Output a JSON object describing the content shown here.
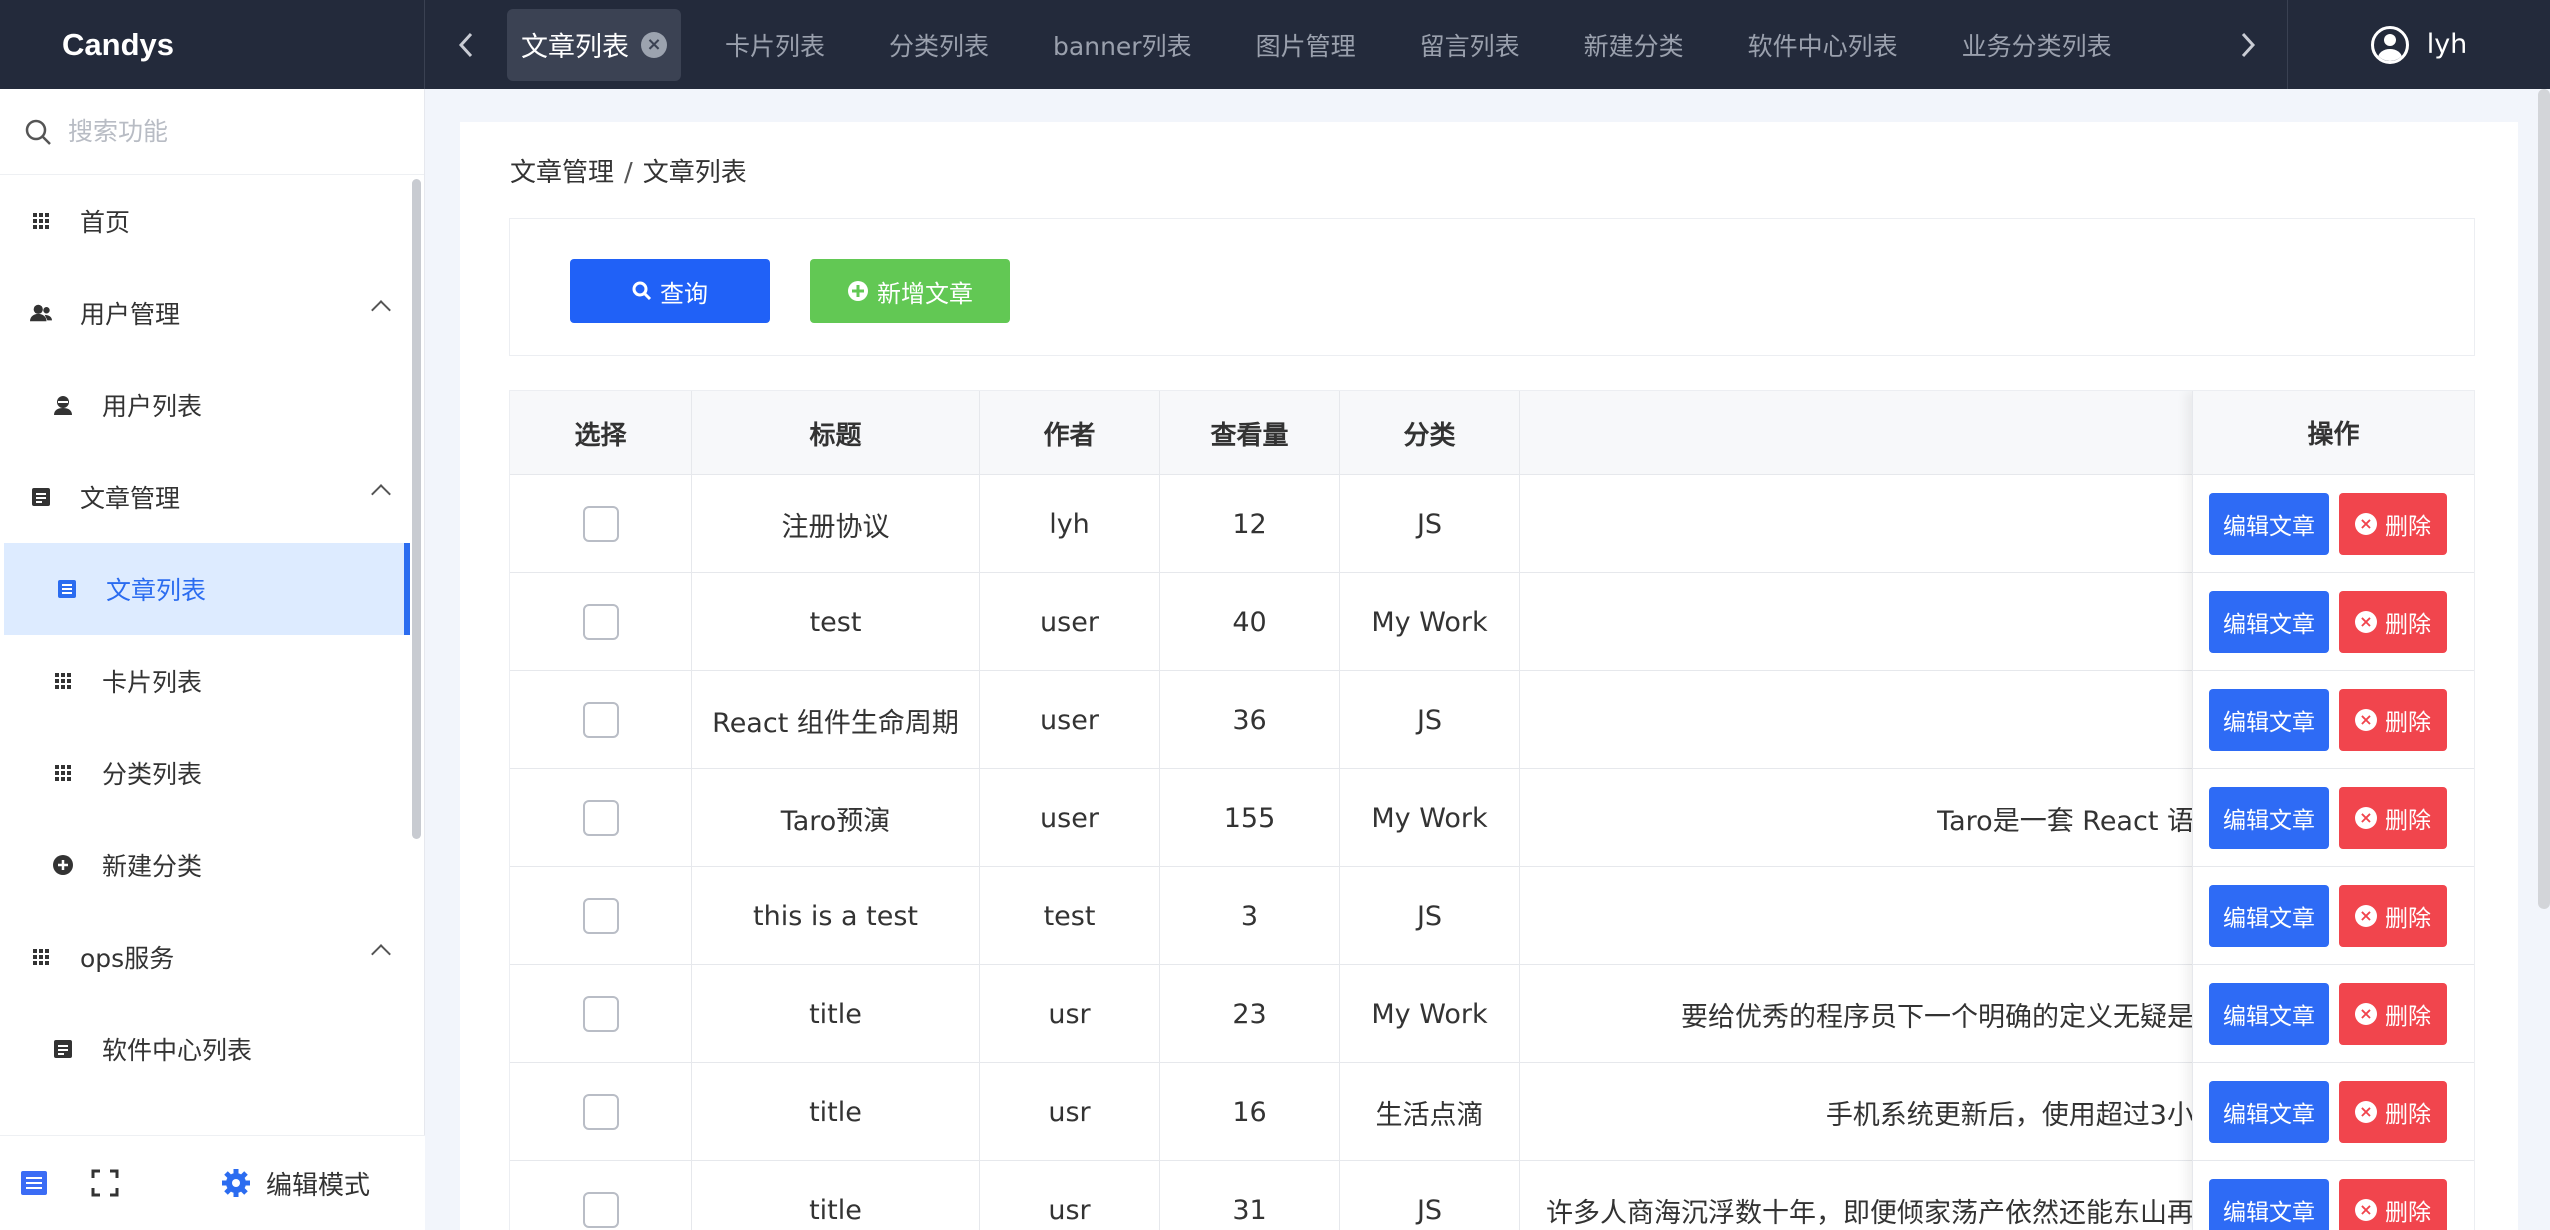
{
  "app": {
    "brand": "Candys"
  },
  "topbar": {
    "tabs": [
      {
        "label": "文章列表",
        "active": true
      },
      {
        "label": "卡片列表"
      },
      {
        "label": "分类列表"
      },
      {
        "label": "banner列表"
      },
      {
        "label": "图片管理"
      },
      {
        "label": "留言列表"
      },
      {
        "label": "新建分类"
      },
      {
        "label": "软件中心列表"
      },
      {
        "label": "业务分类列表"
      }
    ],
    "close_glyph": "×",
    "user": "lyh"
  },
  "sidebar": {
    "search_placeholder": "搜索功能",
    "items": [
      {
        "label": "首页",
        "icon": "grid-icon",
        "level": 1
      },
      {
        "label": "用户管理",
        "icon": "users-icon",
        "level": 1,
        "expanded": true
      },
      {
        "label": "用户列表",
        "icon": "user-icon",
        "level": 2
      },
      {
        "label": "文章管理",
        "icon": "article-icon",
        "level": 1,
        "expanded": true
      },
      {
        "label": "文章列表",
        "icon": "list-icon",
        "level": 2,
        "active": true
      },
      {
        "label": "卡片列表",
        "icon": "grid-icon",
        "level": 2
      },
      {
        "label": "分类列表",
        "icon": "grid-icon",
        "level": 2
      },
      {
        "label": "新建分类",
        "icon": "plus-circle-icon",
        "level": 2
      },
      {
        "label": "ops服务",
        "icon": "grid-icon",
        "level": 1,
        "expanded": true
      },
      {
        "label": "软件中心列表",
        "icon": "article-icon",
        "level": 2
      }
    ],
    "footer": {
      "edit_mode": "编辑模式"
    }
  },
  "main": {
    "breadcrumb": {
      "parent": "文章管理",
      "separator": "/",
      "current": "文章列表"
    },
    "toolbar": {
      "query": "查询",
      "add": "新增文章"
    },
    "table": {
      "headers": {
        "select": "选择",
        "title": "标题",
        "author": "作者",
        "views": "查看量",
        "category": "分类",
        "content": "",
        "ops": "操作"
      },
      "rows": [
        {
          "title": "注册协议",
          "author": "lyh",
          "views": "12",
          "category": "JS",
          "content": ""
        },
        {
          "title": "test",
          "author": "user",
          "views": "40",
          "category": "My Work",
          "content": ""
        },
        {
          "title": "React 组件生命周期",
          "author": "user",
          "views": "36",
          "category": "JS",
          "content": ""
        },
        {
          "title": "Taro预演",
          "author": "user",
          "views": "155",
          "category": "My Work",
          "content": "Taro是一套 React 语"
        },
        {
          "title": "this is a test",
          "author": "test",
          "views": "3",
          "category": "JS",
          "content": ""
        },
        {
          "title": "title",
          "author": "usr",
          "views": "23",
          "category": "My Work",
          "content": "要给优秀的程序员下一个明确的定义无疑是"
        },
        {
          "title": "title",
          "author": "usr",
          "views": "16",
          "category": "生活点滴",
          "content": "手机系统更新后，使用超过3小"
        },
        {
          "title": "title",
          "author": "usr",
          "views": "31",
          "category": "JS",
          "content": "许多人商海沉浮数十年，即便倾家荡产依然还能东山再"
        }
      ],
      "edit_label": "编辑文章",
      "delete_label": "删除"
    }
  },
  "colors": {
    "primary": "#2061f7",
    "success": "#62c854",
    "danger": "#f1454d",
    "topbar": "#232a3b",
    "active_bg": "#ddebff"
  }
}
